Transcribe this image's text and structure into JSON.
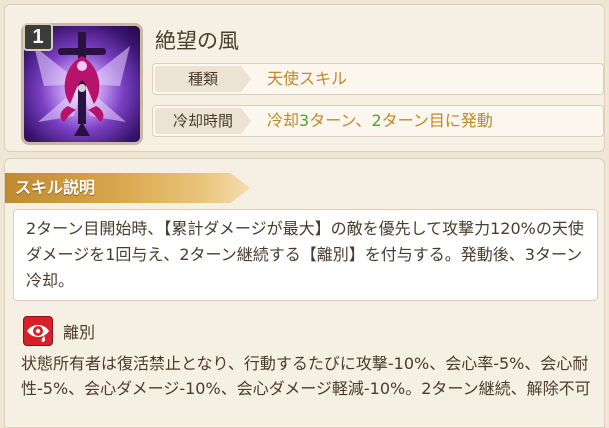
{
  "skill": {
    "rank": "1",
    "name": "絶望の風",
    "type_label": "種類",
    "type_value": "天使スキル",
    "cooldown_label": "冷却時間",
    "cooldown_value": {
      "part1": "冷却",
      "num1": "3",
      "part2": "ターン、",
      "num2": "2",
      "part3": "ターン目に発動"
    },
    "icon": "winged-sword-emblem-icon"
  },
  "description_section": {
    "header": "スキル説明",
    "text": "2ターン目開始時、【累計ダメージが最大】の敵を優先して攻撃力120%の天使ダメージを1回与え、2ターン継続する【離別】を付与する。発動後、3ターン冷却。"
  },
  "effect": {
    "icon": "eye-tear-icon",
    "name": "離別",
    "text": "状態所有者は復活禁止となり、行動するたびに攻撃-10%、会心率-5%、会心耐性-5%、会心ダメージ-10%、会心ダメージ軽減-10%。2ターン継続、解除不可"
  },
  "colors": {
    "value_orange": "#c2872a",
    "number_green": "#5aa02c",
    "header_gold": "#d8a64a",
    "effect_red": "#d8202a"
  }
}
